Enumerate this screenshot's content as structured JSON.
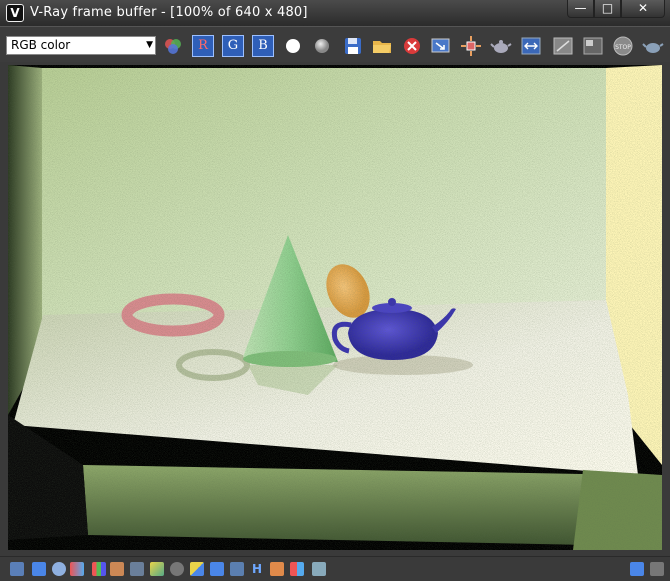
{
  "window": {
    "title": "V-Ray frame buffer - [100% of 640 x 480]",
    "app_icon_glyph": "V",
    "controls": {
      "minimize": "—",
      "maximize": "□",
      "close": "✕"
    }
  },
  "toolbar": {
    "channel_select_value": "RGB color",
    "channel_buttons": {
      "red": "R",
      "green": "G",
      "blue": "B"
    },
    "icons": [
      "color-channels-icon",
      "red-channel-button",
      "green-channel-button",
      "blue-channel-button",
      "white-dot-icon",
      "gray-dot-icon",
      "save-icon",
      "open-folder-icon",
      "clear-image-icon",
      "duplicate-to-mtl-icon",
      "region-render-icon",
      "teapot-render-icon",
      "track-mouse-icon",
      "compare-icon",
      "link-icon",
      "stop-render-icon",
      "teapot-icon"
    ],
    "stop_label": "STOP"
  },
  "statusbar": {
    "letters": {
      "h": "H",
      "hv": "H"
    },
    "colors": {
      "accent": "#4a86e8"
    }
  },
  "colors": {
    "title_bg": "#2b2b2b",
    "toolbar_bg": "#3c3c3c",
    "channel_button": "#2f5fb8",
    "render_bg": "#000000",
    "wall_green": "#bcd3a0",
    "floor": "#fbfaf2",
    "cone": "#7fca7f",
    "teapot": "#3f37b8",
    "torus": "#d98b8f",
    "egg": "#f0b357",
    "right_wall": "#fff9c0"
  }
}
